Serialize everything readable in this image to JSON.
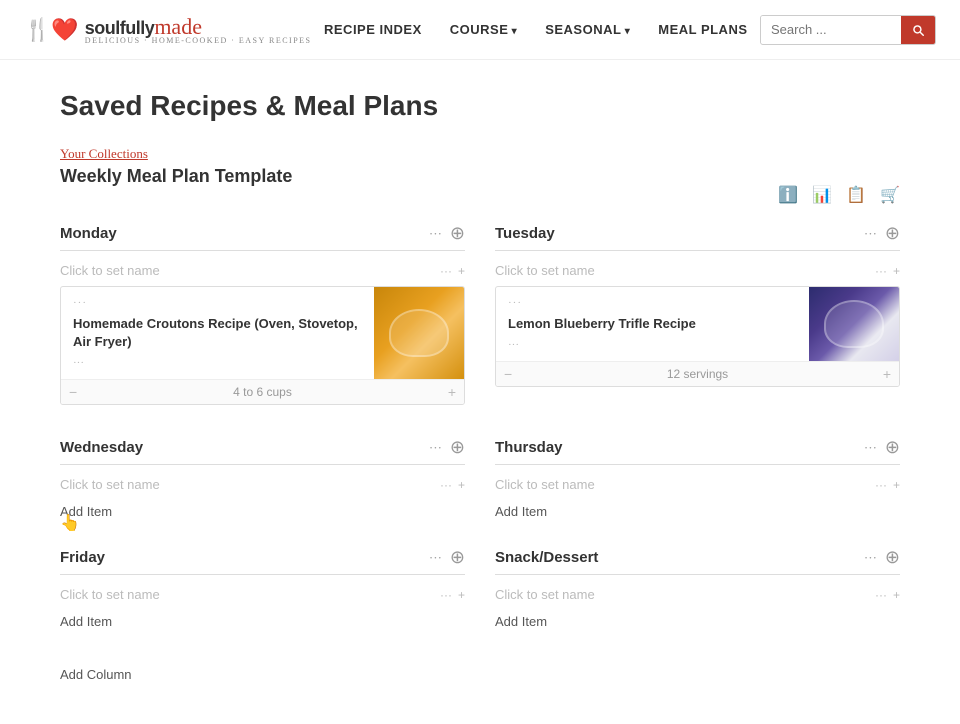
{
  "brand": {
    "icon": "🍴",
    "name_main": "soulfully",
    "name_script": "made",
    "tagline": "DELICIOUS · HOME-COOKED · EASY RECIPES"
  },
  "nav": {
    "links": [
      {
        "label": "RECIPE INDEX",
        "has_arrow": false
      },
      {
        "label": "COURSE",
        "has_arrow": true
      },
      {
        "label": "SEASONAL",
        "has_arrow": true
      },
      {
        "label": "MEAL PLANS",
        "has_arrow": false
      }
    ],
    "search_placeholder": "Search ..."
  },
  "page": {
    "title": "Saved Recipes & Meal Plans"
  },
  "collection": {
    "your_collections_label": "Your Collections",
    "name": "Weekly Meal Plan Template"
  },
  "toolbar_icons": [
    "ℹ",
    "📊",
    "📋",
    "🛒"
  ],
  "days": [
    {
      "id": "monday",
      "name": "Monday",
      "set_name_placeholder": "Click to set name",
      "recipes": [
        {
          "title": "Homemade Croutons Recipe (Oven, Stovetop, Air Fryer)",
          "image_class": "food-croutons",
          "servings": "4 to 6 cups"
        }
      ],
      "add_item": null
    },
    {
      "id": "tuesday",
      "name": "Tuesday",
      "set_name_placeholder": "Click to set name",
      "recipes": [
        {
          "title": "Lemon Blueberry Trifle Recipe",
          "image_class": "food-blueberry",
          "servings": "12 servings"
        }
      ],
      "add_item": null
    },
    {
      "id": "wednesday",
      "name": "Wednesday",
      "set_name_placeholder": "Click to set name",
      "recipes": [],
      "add_item": "Add Item"
    },
    {
      "id": "thursday",
      "name": "Thursday",
      "set_name_placeholder": "Click to set name",
      "recipes": [],
      "add_item": "Add Item"
    },
    {
      "id": "friday",
      "name": "Friday",
      "set_name_placeholder": "Click to set name",
      "recipes": [],
      "add_item": "Add Item"
    },
    {
      "id": "snack-dessert",
      "name": "Snack/Dessert",
      "set_name_placeholder": "Click to set name",
      "recipes": [],
      "add_item": "Add Item"
    }
  ],
  "add_column_label": "Add Column"
}
